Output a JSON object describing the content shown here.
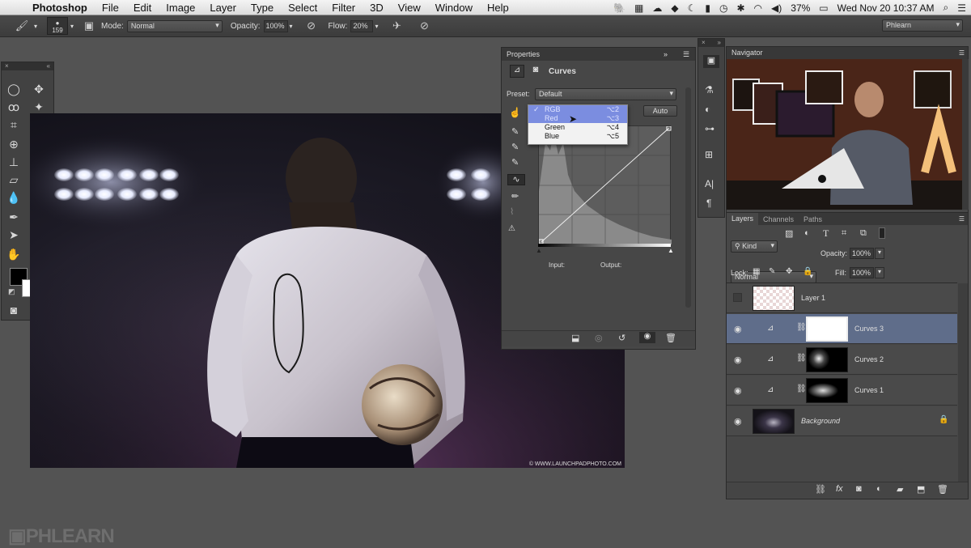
{
  "menubar": {
    "app": "Photoshop",
    "items": [
      "File",
      "Edit",
      "Image",
      "Layer",
      "Type",
      "Select",
      "Filter",
      "3D",
      "View",
      "Window",
      "Help"
    ],
    "battery": "37%",
    "datetime": "Wed Nov 20  10:37 AM"
  },
  "options": {
    "brush_size": "159",
    "mode_label": "Mode:",
    "mode_value": "Normal",
    "opacity_label": "Opacity:",
    "opacity_value": "100%",
    "flow_label": "Flow:",
    "flow_value": "20%",
    "workspace": "Phlearn"
  },
  "properties": {
    "tab": "Properties",
    "title": "Curves",
    "preset_label": "Preset:",
    "preset_value": "Default",
    "auto_label": "Auto",
    "input_label": "Input:",
    "output_label": "Output:",
    "channel_menu": [
      {
        "label": "RGB",
        "shortcut": "⌥2",
        "checked": true,
        "highlight": true
      },
      {
        "label": "Red",
        "shortcut": "⌥3",
        "checked": false,
        "highlight": true
      },
      {
        "label": "Green",
        "shortcut": "⌥4",
        "checked": false,
        "highlight": false
      },
      {
        "label": "Blue",
        "shortcut": "⌥5",
        "checked": false,
        "highlight": false
      }
    ]
  },
  "navigator": {
    "tab": "Navigator"
  },
  "layers_panel": {
    "tabs": [
      "Layers",
      "Channels",
      "Paths"
    ],
    "filter_label": "Kind",
    "blend_mode": "Normal",
    "opacity_label": "Opacity:",
    "opacity_value": "100%",
    "lock_label": "Lock:",
    "fill_label": "Fill:",
    "fill_value": "100%",
    "layers": [
      {
        "name": "Layer 1",
        "visible": false,
        "selected": false
      },
      {
        "name": "Curves 3",
        "visible": true,
        "selected": true
      },
      {
        "name": "Curves 2",
        "visible": true,
        "selected": false
      },
      {
        "name": "Curves 1",
        "visible": true,
        "selected": false
      },
      {
        "name": "Background",
        "visible": true,
        "selected": false
      }
    ]
  },
  "canvas": {
    "copyright": "© WWW.LAUNCHPADPHOTO.COM"
  },
  "watermark": "PHLEARN"
}
